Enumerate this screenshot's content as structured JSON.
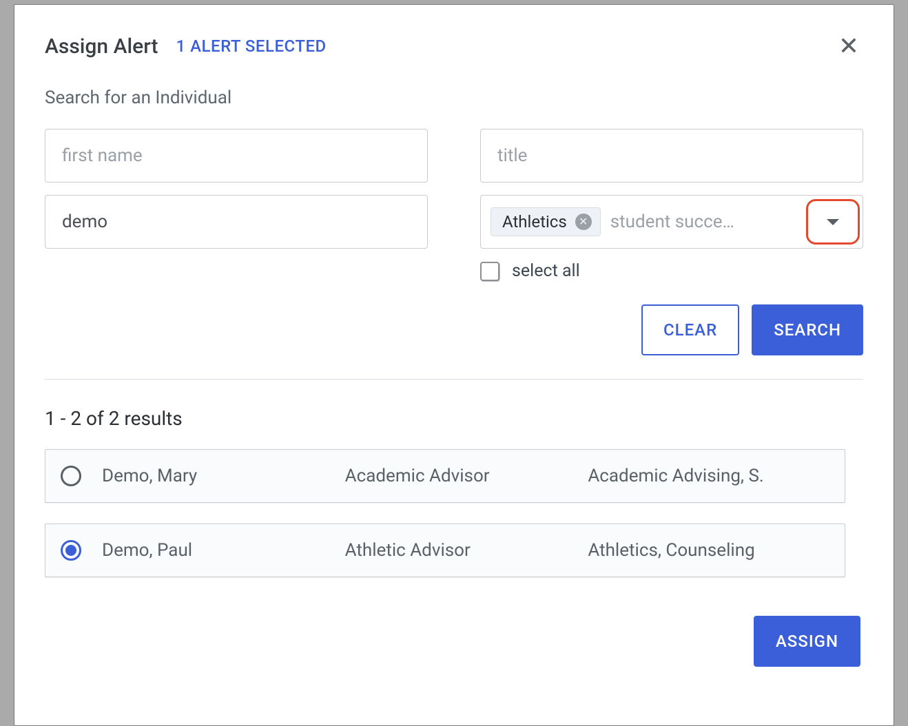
{
  "modal": {
    "title": "Assign Alert",
    "selected_text": "1 ALERT SELECTED"
  },
  "search": {
    "section_label": "Search for an Individual",
    "first_name_placeholder": "first name",
    "last_name_value": "demo",
    "title_placeholder": "title",
    "chip_label": "Athletics",
    "multi_placeholder": "student succe…",
    "select_all_label": "select all"
  },
  "buttons": {
    "clear": "CLEAR",
    "search": "SEARCH",
    "assign": "ASSIGN"
  },
  "results": {
    "count_text": "1 - 2 of 2 results",
    "rows": [
      {
        "selected": false,
        "name": "Demo, Mary",
        "title": "Academic Advisor",
        "dept": "Academic Advising, S."
      },
      {
        "selected": true,
        "name": "Demo, Paul",
        "title": "Athletic Advisor",
        "dept": "Athletics, Counseling"
      }
    ]
  }
}
